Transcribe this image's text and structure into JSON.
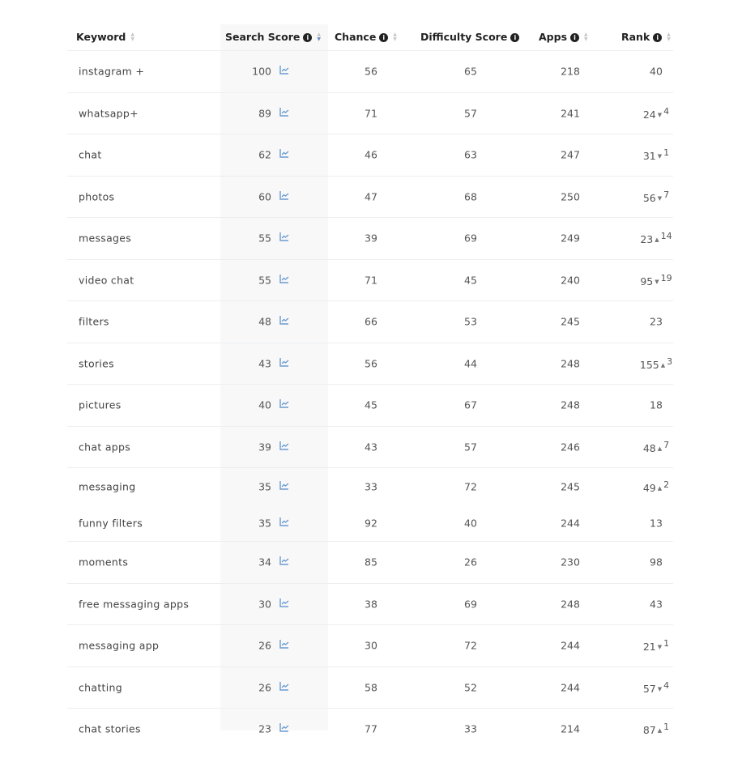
{
  "columns": {
    "keyword": "Keyword",
    "search_score": "Search Score",
    "chance": "Chance",
    "difficulty": "Difficulty Score",
    "apps": "Apps",
    "rank": "Rank"
  },
  "info_icon": "i",
  "trend_icon": "line-chart-icon",
  "accent_color": "#6a9bd0",
  "rows": [
    {
      "keyword": "instagram +",
      "search_score": "100",
      "chance": "56",
      "difficulty": "65",
      "apps": "218",
      "rank": "40",
      "change": "",
      "dir": ""
    },
    {
      "keyword": "whatsapp+",
      "search_score": "89",
      "chance": "71",
      "difficulty": "57",
      "apps": "241",
      "rank": "24",
      "change": "4",
      "dir": "down"
    },
    {
      "keyword": "chat",
      "search_score": "62",
      "chance": "46",
      "difficulty": "63",
      "apps": "247",
      "rank": "31",
      "change": "1",
      "dir": "down"
    },
    {
      "keyword": "photos",
      "search_score": "60",
      "chance": "47",
      "difficulty": "68",
      "apps": "250",
      "rank": "56",
      "change": "7",
      "dir": "down"
    },
    {
      "keyword": "messages",
      "search_score": "55",
      "chance": "39",
      "difficulty": "69",
      "apps": "249",
      "rank": "23",
      "change": "14",
      "dir": "up"
    },
    {
      "keyword": "video chat",
      "search_score": "55",
      "chance": "71",
      "difficulty": "45",
      "apps": "240",
      "rank": "95",
      "change": "19",
      "dir": "down"
    },
    {
      "keyword": "filters",
      "search_score": "48",
      "chance": "66",
      "difficulty": "53",
      "apps": "245",
      "rank": "23",
      "change": "",
      "dir": ""
    },
    {
      "keyword": "stories",
      "search_score": "43",
      "chance": "56",
      "difficulty": "44",
      "apps": "248",
      "rank": "155",
      "change": "3",
      "dir": "up"
    },
    {
      "keyword": "pictures",
      "search_score": "40",
      "chance": "45",
      "difficulty": "67",
      "apps": "248",
      "rank": "18",
      "change": "",
      "dir": ""
    },
    {
      "keyword": "chat apps",
      "search_score": "39",
      "chance": "43",
      "difficulty": "57",
      "apps": "246",
      "rank": "48",
      "change": "7",
      "dir": "up"
    },
    {
      "keyword": "messaging",
      "search_score": "35",
      "chance": "33",
      "difficulty": "72",
      "apps": "245",
      "rank": "49",
      "change": "2",
      "dir": "up"
    },
    {
      "keyword": "funny filters",
      "search_score": "35",
      "chance": "92",
      "difficulty": "40",
      "apps": "244",
      "rank": "13",
      "change": "",
      "dir": ""
    },
    {
      "keyword": "moments",
      "search_score": "34",
      "chance": "85",
      "difficulty": "26",
      "apps": "230",
      "rank": "98",
      "change": "",
      "dir": ""
    },
    {
      "keyword": "free messaging apps",
      "search_score": "30",
      "chance": "38",
      "difficulty": "69",
      "apps": "248",
      "rank": "43",
      "change": "",
      "dir": ""
    },
    {
      "keyword": "messaging app",
      "search_score": "26",
      "chance": "30",
      "difficulty": "72",
      "apps": "244",
      "rank": "21",
      "change": "1",
      "dir": "down"
    },
    {
      "keyword": "chatting",
      "search_score": "26",
      "chance": "58",
      "difficulty": "52",
      "apps": "244",
      "rank": "57",
      "change": "4",
      "dir": "down"
    },
    {
      "keyword": "chat stories",
      "search_score": "23",
      "chance": "77",
      "difficulty": "33",
      "apps": "214",
      "rank": "87",
      "change": "1",
      "dir": "up"
    }
  ]
}
